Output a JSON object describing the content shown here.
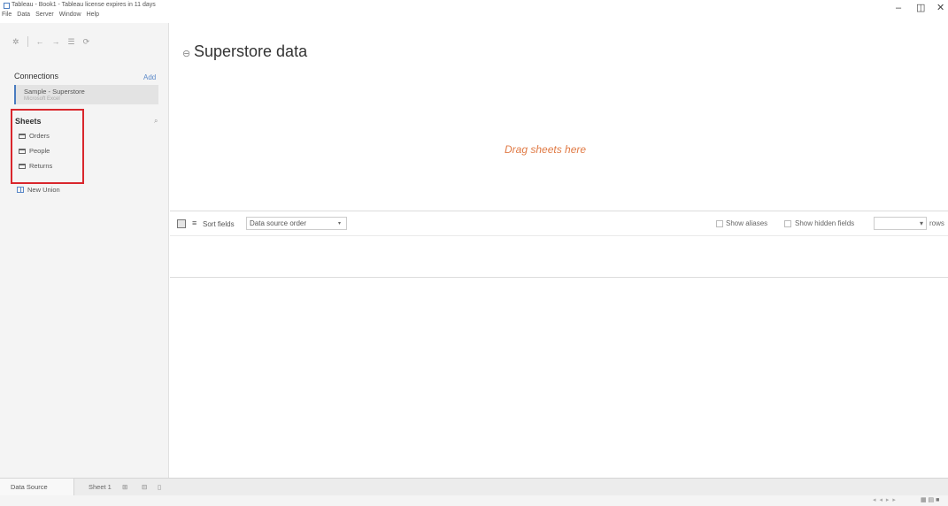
{
  "window": {
    "title": "Tableau - Book1 - Tableau license expires in 11 days",
    "minimize_glyph": "–",
    "maximize_glyph": "◫",
    "close_glyph": "✕"
  },
  "menu": [
    "File",
    "Data",
    "Server",
    "Window",
    "Help"
  ],
  "toolbar": {
    "home_glyph": "✲",
    "back_glyph": "←",
    "forward_glyph": "→",
    "save_glyph": "☰",
    "refresh_glyph": "⟳"
  },
  "connections": {
    "title": "Connections",
    "add_label": "Add",
    "items": [
      {
        "name": "Sample - Superstore",
        "type": "Microsoft Excel"
      }
    ]
  },
  "sheets": {
    "title": "Sheets",
    "search_glyph": "⌕",
    "items": [
      "Orders",
      "People",
      "Returns"
    ],
    "new_union": "New Union"
  },
  "datasource": {
    "icon_glyph": "⊖",
    "title": "Superstore data",
    "drop_hint": "Drag sheets here"
  },
  "grid_toolbar": {
    "list_glyph": "≡",
    "sort_label": "Sort fields",
    "sort_value": "Data source order",
    "show_aliases": "Show aliases",
    "show_hidden": "Show hidden fields",
    "rows_label": "rows",
    "rows_caret": "▾",
    "select_caret": "▾"
  },
  "bottom_tabs": {
    "data_source": "Data Source",
    "sheet1": "Sheet 1"
  },
  "accent_colors": {
    "highlight_box": "#d9262c",
    "drop_hint": "#e07a45",
    "link": "#5a88c8"
  }
}
